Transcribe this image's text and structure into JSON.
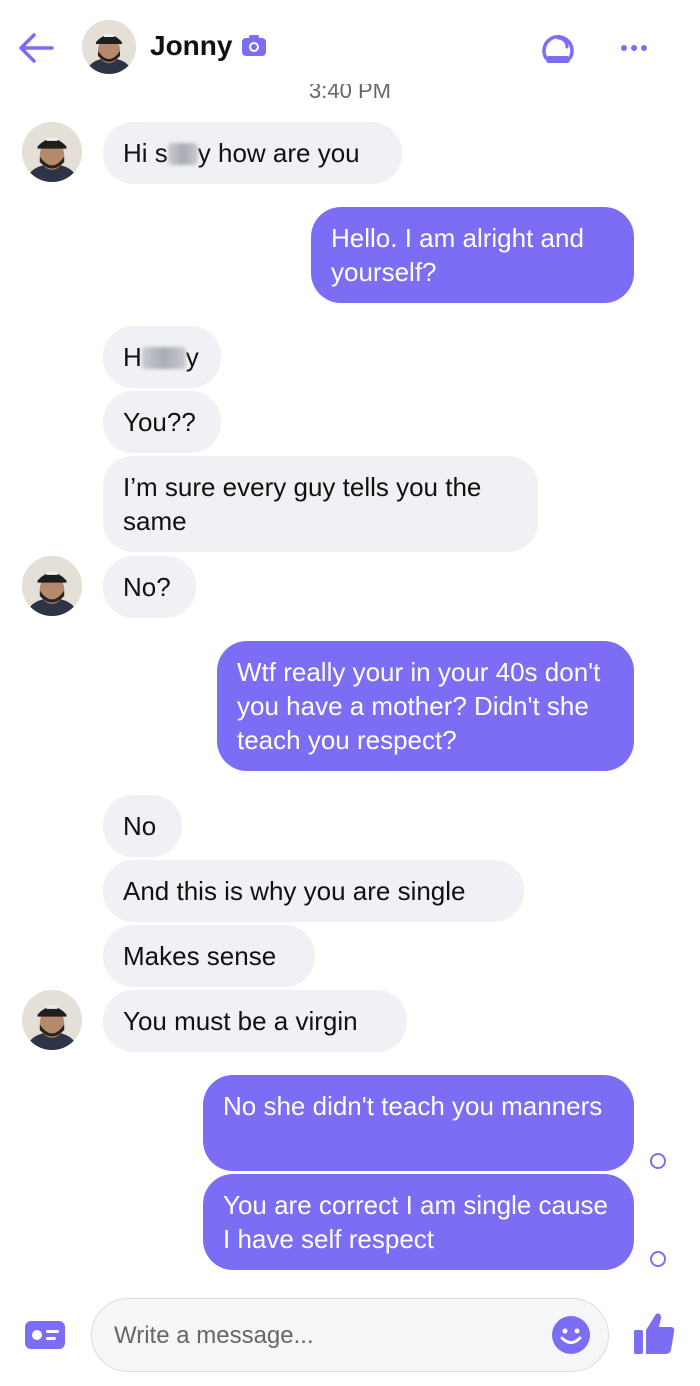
{
  "header": {
    "contact_name": "Jonny",
    "icons": [
      "back-arrow-icon",
      "camera-icon",
      "call-icon",
      "more-options-icon"
    ]
  },
  "conversation": {
    "timestamp": "3:40 PM",
    "messages": [
      {
        "from": "them",
        "parts": [
          "Hi s",
          "y how are you"
        ]
      },
      {
        "from": "me",
        "text": "Hello. I am alright and yourself?"
      },
      {
        "from": "them",
        "parts": [
          "H",
          "y"
        ]
      },
      {
        "from": "them",
        "text": "You??"
      },
      {
        "from": "them",
        "text": "I’m sure every guy tells you the same"
      },
      {
        "from": "them",
        "text": "No?"
      },
      {
        "from": "me",
        "text": "Wtf really your in your 40s don't you have a mother? Didn't she teach you respect?"
      },
      {
        "from": "them",
        "text": "No"
      },
      {
        "from": "them",
        "text": "And this is why you are single"
      },
      {
        "from": "them",
        "text": "Makes sense"
      },
      {
        "from": "them",
        "text": "You must be a virgin"
      },
      {
        "from": "me",
        "text": "No she didn't teach you manners"
      },
      {
        "from": "me",
        "text": "You are correct I am single cause I have self respect"
      }
    ]
  },
  "composer": {
    "placeholder": "Write a message...",
    "icons": [
      "contact-card-icon",
      "emoji-icon",
      "thumbs-up-icon"
    ]
  },
  "colors": {
    "accent": "#7c6df5",
    "incoming_bubble": "#eff1f4",
    "text": "#111111"
  }
}
